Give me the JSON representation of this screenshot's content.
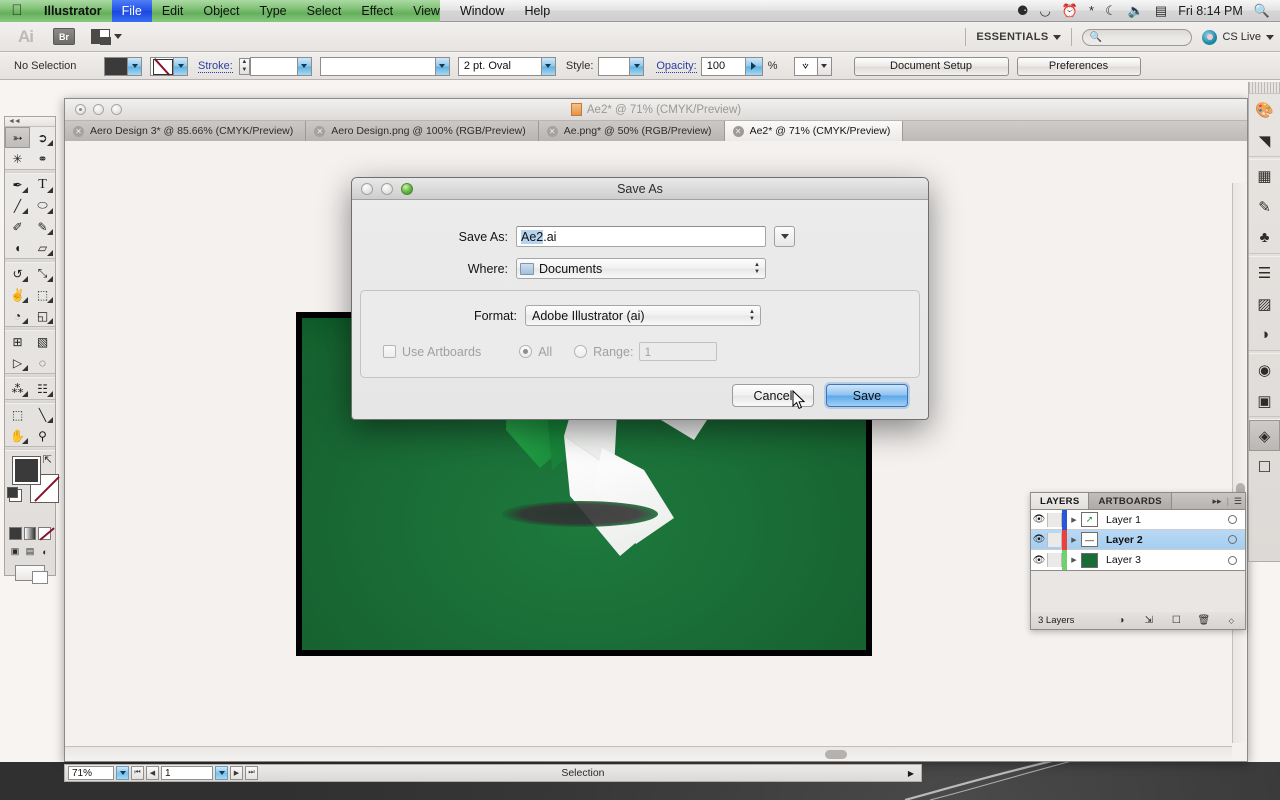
{
  "menubar": {
    "apple_icon": "apple-logo",
    "items": [
      {
        "label": "Illustrator",
        "active": false,
        "bold": true
      },
      {
        "label": "File",
        "active": true,
        "bold": false
      },
      {
        "label": "Edit",
        "active": false,
        "bold": false
      },
      {
        "label": "Object",
        "active": false,
        "bold": false
      },
      {
        "label": "Type",
        "active": false,
        "bold": false
      },
      {
        "label": "Select",
        "active": false,
        "bold": false
      },
      {
        "label": "Effect",
        "active": false,
        "bold": false
      },
      {
        "label": "View",
        "active": false,
        "bold": false
      },
      {
        "label": "Window",
        "active": false,
        "bold": false
      },
      {
        "label": "Help",
        "active": false,
        "bold": false
      }
    ],
    "status_icons": [
      "dropbox-icon",
      "bowler-hat-icon",
      "time-machine-icon",
      "bluetooth-icon",
      "wifi-icon",
      "volume-icon",
      "battery-icon"
    ],
    "clock": "Fri 8:14 PM",
    "spotlight_icon": "search-icon"
  },
  "appbar": {
    "app_logo": "Ai",
    "bridge_label": "Br",
    "arrange_icon": "arrange-documents-icon",
    "workspace": "ESSENTIALS",
    "search_placeholder": "",
    "search_value": "",
    "cslive_label": "CS Live"
  },
  "controlbar": {
    "selection_label": "No Selection",
    "fill_color": "#3a3a3a",
    "stroke_swatch": "none-swatch",
    "stroke_label": "Stroke:",
    "stroke_weight": "",
    "stroke_profile": "",
    "brush_definition": "2 pt. Oval",
    "style_label": "Style:",
    "style_value": "",
    "opacity_label": "Opacity:",
    "opacity_value": "100",
    "opacity_unit": "%",
    "document_setup": "Document Setup",
    "preferences": "Preferences"
  },
  "toolbox": {
    "tools": [
      {
        "name": "selection-tool",
        "glyph": "⬆",
        "selected": true,
        "corner": false
      },
      {
        "name": "direct-selection-tool",
        "glyph": "⬈",
        "selected": false,
        "corner": true
      },
      {
        "name": "magic-wand-tool",
        "glyph": "✳",
        "selected": false,
        "corner": false
      },
      {
        "name": "lasso-tool",
        "glyph": "❦",
        "selected": false,
        "corner": false
      },
      {
        "name": "pen-tool",
        "glyph": "✒",
        "selected": false,
        "corner": true
      },
      {
        "name": "type-tool",
        "glyph": "T",
        "selected": false,
        "corner": true
      },
      {
        "name": "line-segment-tool",
        "glyph": "╲",
        "selected": false,
        "corner": true
      },
      {
        "name": "ellipse-tool",
        "glyph": "⬭",
        "selected": false,
        "corner": true
      },
      {
        "name": "paintbrush-tool",
        "glyph": "✐",
        "selected": false,
        "corner": false
      },
      {
        "name": "pencil-tool",
        "glyph": "✏",
        "selected": false,
        "corner": true
      },
      {
        "name": "blob-brush-tool",
        "glyph": "◖",
        "selected": false,
        "corner": false
      },
      {
        "name": "eraser-tool",
        "glyph": "▱",
        "selected": false,
        "corner": true
      },
      {
        "name": "rotate-tool",
        "glyph": "↺",
        "selected": false,
        "corner": true
      },
      {
        "name": "scale-tool",
        "glyph": "⤡",
        "selected": false,
        "corner": true
      },
      {
        "name": "width-tool",
        "glyph": "✂",
        "selected": false,
        "corner": true
      },
      {
        "name": "free-transform-tool",
        "glyph": "⬚",
        "selected": false,
        "corner": false
      },
      {
        "name": "shape-builder-tool",
        "glyph": "◔",
        "selected": false,
        "corner": true
      },
      {
        "name": "perspective-grid-tool",
        "glyph": "◱",
        "selected": false,
        "corner": true
      },
      {
        "name": "mesh-tool",
        "glyph": "⊞",
        "selected": false,
        "corner": false
      },
      {
        "name": "gradient-tool",
        "glyph": "▧",
        "selected": false,
        "corner": false
      },
      {
        "name": "eyedropper-tool",
        "glyph": "⚗",
        "selected": false,
        "corner": true
      },
      {
        "name": "blend-tool",
        "glyph": "◌",
        "selected": false,
        "corner": false
      },
      {
        "name": "symbol-sprayer-tool",
        "glyph": "⁂",
        "selected": false,
        "corner": true
      },
      {
        "name": "column-graph-tool",
        "glyph": "☷",
        "selected": false,
        "corner": true
      },
      {
        "name": "artboard-tool",
        "glyph": "⬚",
        "selected": false,
        "corner": false
      },
      {
        "name": "slice-tool",
        "glyph": "╱",
        "selected": false,
        "corner": true
      },
      {
        "name": "hand-tool",
        "glyph": "✋",
        "selected": false,
        "corner": true
      },
      {
        "name": "zoom-tool",
        "glyph": "⚲",
        "selected": false,
        "corner": false
      }
    ],
    "fill_color": "#3a3a3a",
    "stroke_color": "#ffffff",
    "draw_modes": [
      "draw-normal-icon",
      "draw-behind-icon",
      "draw-inside-icon"
    ],
    "color_modes": [
      "color-swatch-icon",
      "gradient-icon",
      "none-icon"
    ]
  },
  "document": {
    "window_title": "Ae2* @ 71% (CMYK/Preview)",
    "tabs": [
      {
        "label": "Aero Design 3* @ 85.66% (CMYK/Preview)",
        "active": false
      },
      {
        "label": "Aero Design.png @ 100% (RGB/Preview)",
        "active": false
      },
      {
        "label": "Ae.png* @ 50% (RGB/Preview)",
        "active": false
      },
      {
        "label": "Ae2* @ 71% (CMYK/Preview)",
        "active": true
      }
    ]
  },
  "statusbar": {
    "zoom": "71%",
    "artboard_number": "1",
    "status_text": "Selection"
  },
  "dock": {
    "icons": [
      {
        "name": "color-panel-icon",
        "glyph": "❀",
        "selected": false
      },
      {
        "name": "color-guide-panel-icon",
        "glyph": "◥",
        "selected": false
      },
      {
        "name": "swatches-panel-icon",
        "glyph": "▓",
        "selected": false
      },
      {
        "name": "brushes-panel-icon",
        "glyph": "⚘",
        "selected": false
      },
      {
        "name": "symbols-panel-icon",
        "glyph": "♣",
        "selected": false
      },
      {
        "name": "stroke-panel-icon",
        "glyph": "☰",
        "selected": false
      },
      {
        "name": "gradient-panel-icon",
        "glyph": "▨",
        "selected": false
      },
      {
        "name": "transparency-panel-icon",
        "glyph": "◑",
        "selected": false
      },
      {
        "name": "appearance-panel-icon",
        "glyph": "◉",
        "selected": false
      },
      {
        "name": "graphic-styles-panel-icon",
        "glyph": "❐",
        "selected": false
      },
      {
        "name": "layers-panel-icon",
        "glyph": "◈",
        "selected": true
      },
      {
        "name": "artboards-panel-icon",
        "glyph": "❐",
        "selected": false
      }
    ]
  },
  "layers_panel": {
    "tabs": [
      {
        "label": "LAYERS",
        "active": true
      },
      {
        "label": "ARTBOARDS",
        "active": false
      }
    ],
    "collapse_icon": "collapse-icon",
    "menu_icon": "panel-menu-icon",
    "rows": [
      {
        "name": "Layer 1",
        "color": "#2a57d6",
        "selected": false,
        "thumb": "arrow-thumbnail",
        "visible": true
      },
      {
        "name": "Layer 2",
        "color": "#e8423c",
        "selected": true,
        "thumb": "line-thumbnail",
        "visible": true
      },
      {
        "name": "Layer 3",
        "color": "#6ed06e",
        "selected": false,
        "thumb": "green-fill-thumbnail",
        "visible": true
      }
    ],
    "footer_count": "3 Layers",
    "footer_buttons": [
      "make-clipping-mask-icon",
      "create-sublayer-icon",
      "create-new-layer-icon",
      "delete-selection-icon"
    ]
  },
  "save_dialog": {
    "title": "Save As",
    "save_as_label": "Save As:",
    "filename_selected": "Ae2",
    "filename_rest": ".ai",
    "where_label": "Where:",
    "where_value": "Documents",
    "format_label": "Format:",
    "format_value": "Adobe Illustrator (ai)",
    "use_artboards_label": "Use Artboards",
    "all_label": "All",
    "range_label": "Range:",
    "range_value": "1",
    "cancel_label": "Cancel",
    "save_label": "Save"
  },
  "artwork": {
    "background_color": "#1a6c36",
    "shape_color": "#ffffff",
    "accent_color": "#27a844",
    "shadow_color": "#3a3a3a"
  }
}
